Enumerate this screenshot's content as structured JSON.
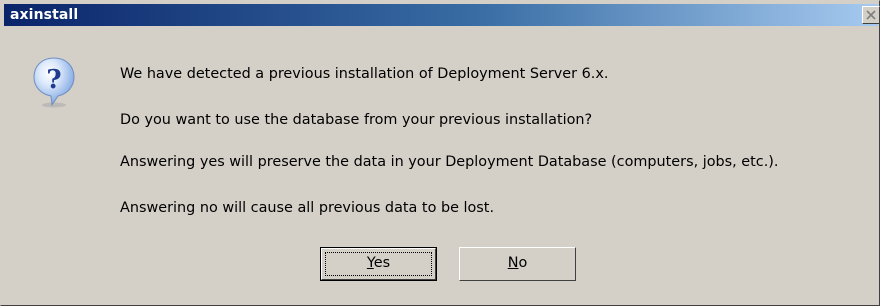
{
  "window": {
    "title": "axinstall"
  },
  "icon": {
    "name": "question-icon",
    "glyph": "?"
  },
  "message": {
    "line1": "We have detected a previous installation of Deployment Server 6.x.",
    "line2": "Do you want to use the database from your previous installation?",
    "line3": "Answering yes will preserve the data in your Deployment Database (computers, jobs, etc.).",
    "line4": "Answering no will cause all previous data to be lost."
  },
  "buttons": {
    "yes": {
      "mnemonic": "Y",
      "rest": "es"
    },
    "no": {
      "mnemonic": "N",
      "rest": "o"
    }
  },
  "colors": {
    "titlebar_start": "#0a246a",
    "titlebar_end": "#a6caf0",
    "dialog_face": "#d4d0c8"
  }
}
